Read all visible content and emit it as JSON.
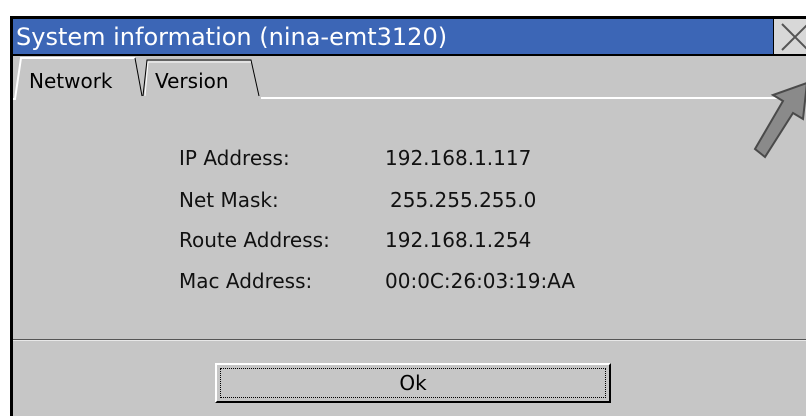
{
  "window": {
    "title": "System information (nina-emt3120)",
    "close_icon": "close-x-icon"
  },
  "tabs": [
    {
      "label": "Network",
      "active": true
    },
    {
      "label": "Version",
      "active": false
    }
  ],
  "network": {
    "rows": [
      {
        "label": "IP Address:",
        "value": "192.168.1.117"
      },
      {
        "label": "Net Mask:",
        "value": "255.255.255.0"
      },
      {
        "label": "Route Address:",
        "value": "192.168.1.254"
      },
      {
        "label": "Mac Address:",
        "value": "00:0C:26:03:19:AA"
      }
    ]
  },
  "footer": {
    "ok_label": "Ok"
  },
  "colors": {
    "titlebar": "#3c66b6",
    "dialog_bg": "#c6c6c6"
  }
}
